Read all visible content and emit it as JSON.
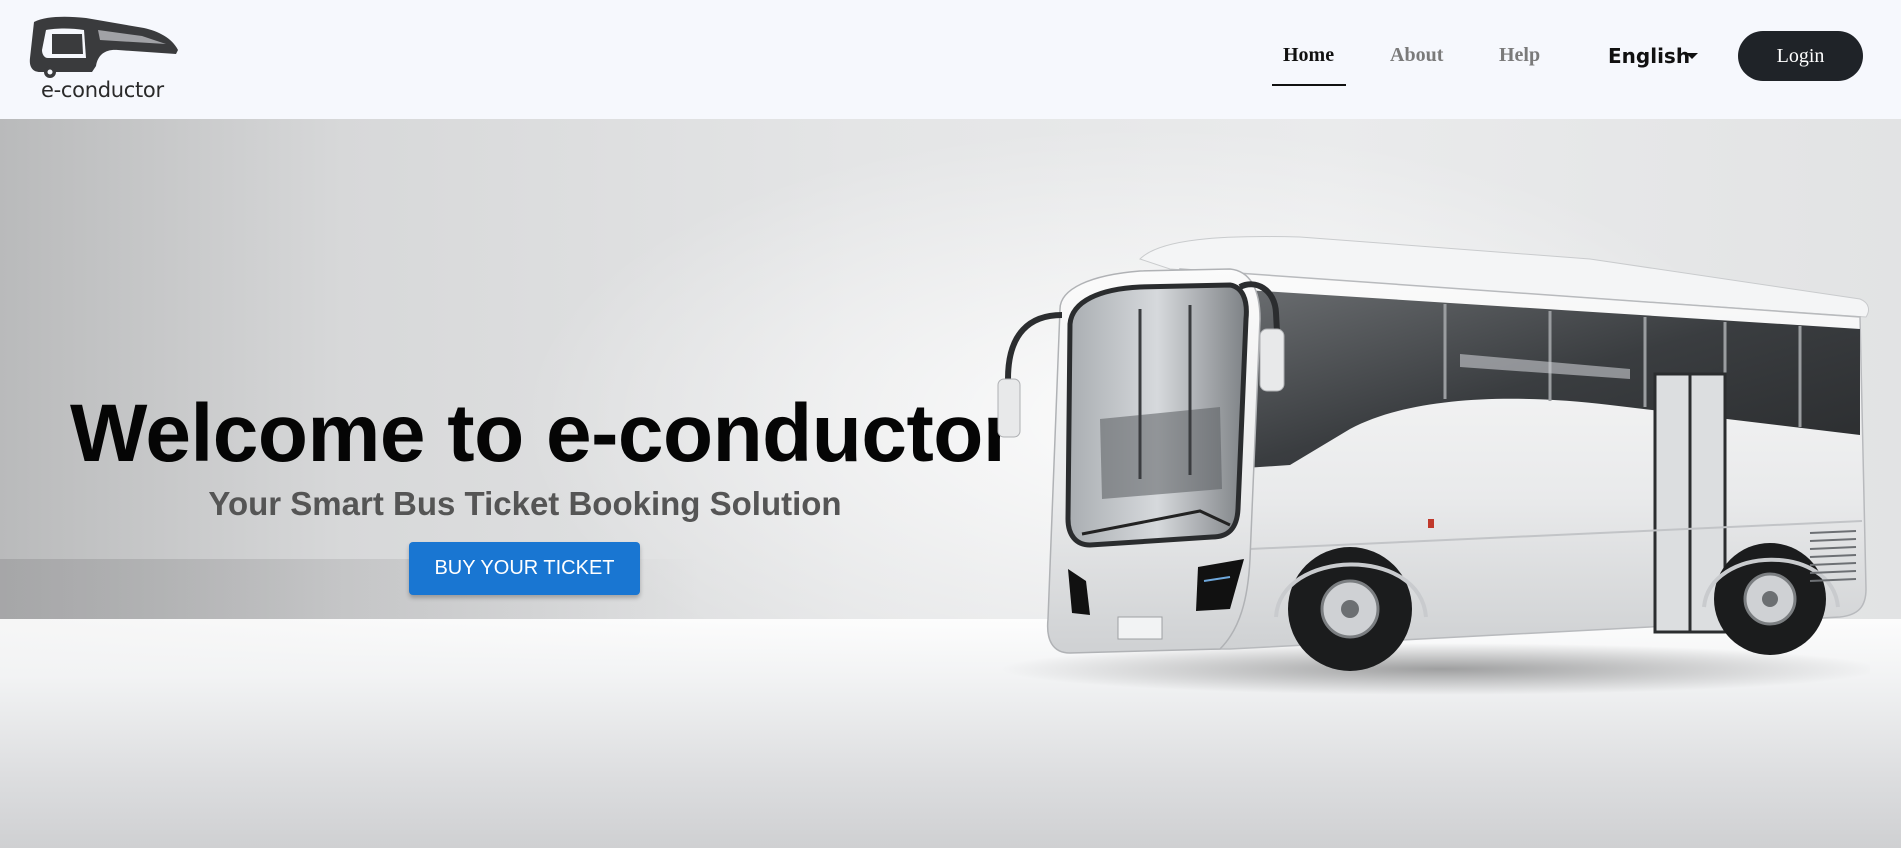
{
  "brand": {
    "name": "e-conductor",
    "logo_icon": "bus-logo-icon"
  },
  "nav": {
    "links": [
      {
        "label": "Home",
        "active": true
      },
      {
        "label": "About",
        "active": false
      },
      {
        "label": "Help",
        "active": false
      }
    ],
    "language": "English",
    "login_label": "Login"
  },
  "hero": {
    "title": "Welcome to e-conductor",
    "subtitle": "Your Smart Bus Ticket Booking Solution",
    "cta_label": "BUY YOUR TICKET",
    "image": "white-bus-image"
  },
  "colors": {
    "navbar_bg": "#f6f8fd",
    "login_bg": "#1f2328",
    "cta_bg": "#1976d2"
  }
}
